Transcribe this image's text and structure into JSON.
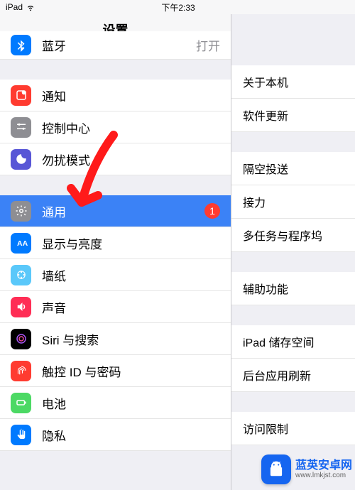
{
  "statusbar": {
    "device": "iPad",
    "time": "下午2:33"
  },
  "sidebar": {
    "title": "设置",
    "items": {
      "bluetooth": {
        "label": "蓝牙",
        "value": "打开",
        "color": "#007aff"
      },
      "notifications": {
        "label": "通知",
        "color": "#ff3b30"
      },
      "control_center": {
        "label": "控制中心",
        "color": "#8e8e93"
      },
      "dnd": {
        "label": "勿扰模式",
        "color": "#5856d6"
      },
      "general": {
        "label": "通用",
        "badge": "1",
        "color": "#8e8e93"
      },
      "display": {
        "label": "显示与亮度",
        "color": "#007aff"
      },
      "wallpaper": {
        "label": "墙纸",
        "color": "#5ac8fa"
      },
      "sound": {
        "label": "声音",
        "color": "#ff2d55"
      },
      "siri": {
        "label": "Siri 与搜索",
        "color": "#000"
      },
      "touchid": {
        "label": "触控 ID 与密码",
        "color": "#ff3b30"
      },
      "battery": {
        "label": "电池",
        "color": "#4cd964"
      },
      "privacy": {
        "label": "隐私",
        "color": "#007aff"
      }
    }
  },
  "detail": {
    "about": "关于本机",
    "software_update": "软件更新",
    "airdrop": "隔空投送",
    "handoff": "接力",
    "multitask": "多任务与程序坞",
    "accessibility": "辅助功能",
    "storage": "iPad 储存空间",
    "background_refresh": "后台应用刷新",
    "restrictions": "访问限制"
  },
  "watermark": {
    "title": "蓝英安卓网",
    "url": "www.lmkjst.com"
  },
  "colors": {
    "selected_bg": "#3b82f6",
    "badge_bg": "#ff3b30"
  }
}
